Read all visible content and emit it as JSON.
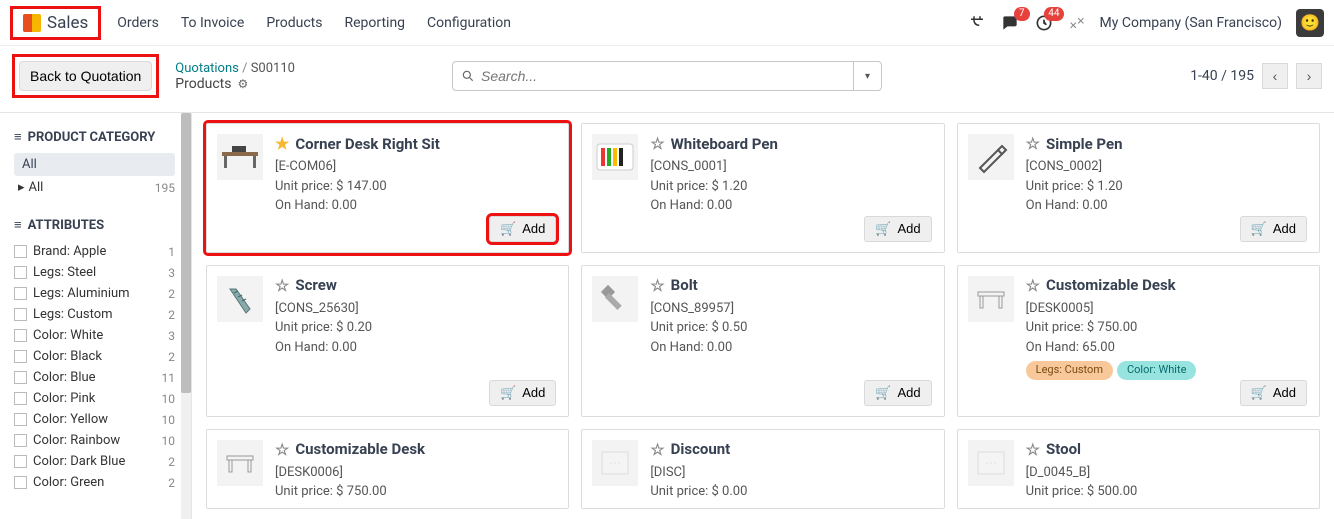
{
  "nav": {
    "brand": "Sales",
    "items": [
      "Orders",
      "To Invoice",
      "Products",
      "Reporting",
      "Configuration"
    ],
    "msg_badge": "7",
    "clock_badge": "44",
    "company": "My Company (San Francisco)"
  },
  "subbar": {
    "back": "Back to Quotation",
    "crumb_root": "Quotations",
    "crumb_leaf": "S00110",
    "crumb_sub": "Products",
    "search_placeholder": "Search...",
    "pager": "1-40 / 195"
  },
  "sidebar": {
    "cat_head": "PRODUCT CATEGORY",
    "all_pill": "All",
    "tree_all": "All",
    "tree_all_count": "195",
    "attr_head": "ATTRIBUTES",
    "attrs": [
      {
        "label": "Brand: Apple",
        "count": "1"
      },
      {
        "label": "Legs: Steel",
        "count": "3"
      },
      {
        "label": "Legs: Aluminium",
        "count": "2"
      },
      {
        "label": "Legs: Custom",
        "count": "2"
      },
      {
        "label": "Color: White",
        "count": "3"
      },
      {
        "label": "Color: Black",
        "count": "2"
      },
      {
        "label": "Color: Blue",
        "count": "11"
      },
      {
        "label": "Color: Pink",
        "count": "10"
      },
      {
        "label": "Color: Yellow",
        "count": "10"
      },
      {
        "label": "Color: Rainbow",
        "count": "10"
      },
      {
        "label": "Color: Dark Blue",
        "count": "2"
      },
      {
        "label": "Color: Green",
        "count": "2"
      }
    ]
  },
  "add_label": "Add",
  "products": [
    {
      "name": "Corner Desk Right Sit",
      "sku": "[E-COM06]",
      "price": "Unit price: $ 147.00",
      "onhand": "On Hand: 0.00",
      "fav": true,
      "hl": true,
      "add_hl": true,
      "tags": [],
      "short": false,
      "has_add": true
    },
    {
      "name": "Whiteboard Pen",
      "sku": "[CONS_0001]",
      "price": "Unit price: $ 1.20",
      "onhand": "On Hand: 0.00",
      "fav": false,
      "hl": false,
      "tags": [],
      "short": false,
      "has_add": true
    },
    {
      "name": "Simple Pen",
      "sku": "[CONS_0002]",
      "price": "Unit price: $ 1.20",
      "onhand": "On Hand: 0.00",
      "fav": false,
      "hl": false,
      "tags": [],
      "short": false,
      "has_add": true
    },
    {
      "name": "Screw",
      "sku": "[CONS_25630]",
      "price": "Unit price: $ 0.20",
      "onhand": "On Hand: 0.00",
      "fav": false,
      "hl": false,
      "tags": [],
      "short": false,
      "has_add": true
    },
    {
      "name": "Bolt",
      "sku": "[CONS_89957]",
      "price": "Unit price: $ 0.50",
      "onhand": "On Hand: 0.00",
      "fav": false,
      "hl": false,
      "tags": [],
      "short": false,
      "has_add": true
    },
    {
      "name": "Customizable Desk",
      "sku": "[DESK0005]",
      "price": "Unit price: $ 750.00",
      "onhand": "On Hand: 65.00",
      "fav": false,
      "hl": false,
      "tags": [
        {
          "text": "Legs: Custom",
          "cls": "orange"
        },
        {
          "text": "Color: White",
          "cls": "teal"
        }
      ],
      "short": false,
      "has_add": true
    },
    {
      "name": "Customizable Desk",
      "sku": "[DESK0006]",
      "price": "Unit price: $ 750.00",
      "onhand": "",
      "fav": false,
      "hl": false,
      "tags": [],
      "short": true,
      "has_add": false
    },
    {
      "name": "Discount",
      "sku": "[DISC]",
      "price": "Unit price: $ 0.00",
      "onhand": "",
      "fav": false,
      "hl": false,
      "tags": [],
      "short": true,
      "has_add": false
    },
    {
      "name": "Stool",
      "sku": "[D_0045_B]",
      "price": "Unit price: $ 500.00",
      "onhand": "",
      "fav": false,
      "hl": false,
      "tags": [],
      "short": true,
      "has_add": false
    }
  ],
  "thumbs": [
    "desk",
    "pens",
    "pen",
    "screw",
    "bolt",
    "desk2",
    "desk2",
    "disc",
    "disc"
  ]
}
